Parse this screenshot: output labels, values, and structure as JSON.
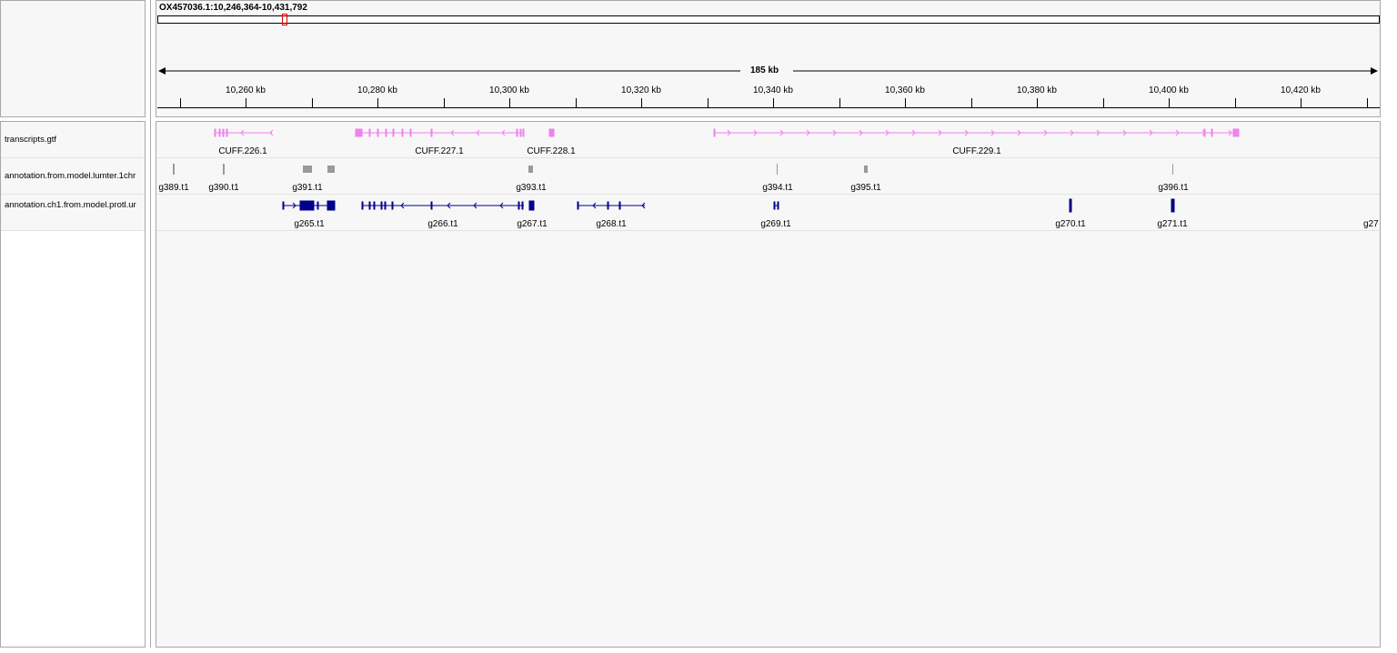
{
  "locus": "OX457036.1:10,246,364-10,431,792",
  "ruler": {
    "span_label": "185 kb",
    "ticks": [
      "10,260 kb",
      "10,280 kb",
      "10,300 kb",
      "10,320 kb",
      "10,340 kb",
      "10,360 kb",
      "10,380 kb",
      "10,400 kb",
      "10,420 kb"
    ]
  },
  "tracks": [
    {
      "name": "transcripts.gtf"
    },
    {
      "name": "annotation.from.model.lumter.1chr"
    },
    {
      "name": "annotation.ch1.from.model.protl.ur"
    }
  ],
  "features": {
    "transcripts": [
      "CUFF.226.1",
      "CUFF.227.1",
      "CUFF.228.1",
      "CUFF.229.1"
    ],
    "lumter": [
      "g389.t1",
      "g390.t1",
      "g391.t1",
      "g393.t1",
      "g394.t1",
      "g395.t1",
      "g396.t1"
    ],
    "prot": [
      "g265.t1",
      "g266.t1",
      "g267.t1",
      "g268.t1",
      "g269.t1",
      "g270.t1",
      "g271.t1",
      "g27"
    ]
  },
  "colors": {
    "transcripts": "#ee82ee",
    "lumter": "#999999",
    "prot": "#00008b",
    "viewport_marker": "#e00000"
  }
}
